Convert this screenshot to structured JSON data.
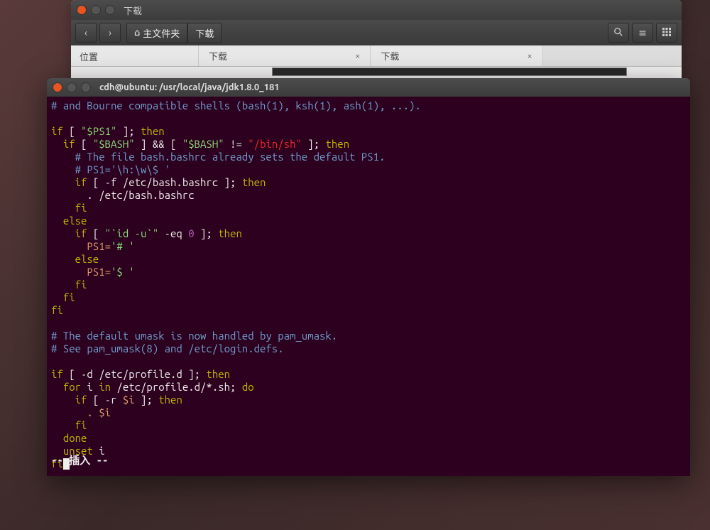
{
  "file_manager": {
    "title": "下载",
    "path": {
      "home": "主文件夹",
      "current": "下载"
    },
    "sidebar_label": "位置",
    "tabs": [
      {
        "label": "下载"
      },
      {
        "label": "下载"
      }
    ]
  },
  "terminal": {
    "title": "cdh@ubuntu: /usr/local/java/jdk1.8.0_181",
    "status": "-- 插入 --",
    "code": {
      "l1_pre": "# and Bourne compatible shells (bash(1), ksh(1), ash(1), ...).",
      "l3_if": "if",
      "l3_b1": " [ ",
      "l3_ps1": "\"$PS1\"",
      "l3_b2": " ]; ",
      "l3_then": "then",
      "l4_if": "if",
      "l4_b1": " [ ",
      "l4_bash1": "\"$BASH\"",
      "l4_b2": " ] ",
      "l4_and": "&&",
      "l4_b3": " [ ",
      "l4_bash2": "\"$BASH\"",
      "l4_ne": " != ",
      "l4_binsh": "\"/bin/sh\"",
      "l4_b4": " ]; ",
      "l4_then": "then",
      "l5": "# The file bash.bashrc already sets the default PS1.",
      "l6": "# PS1='\\h:\\w\\$ '",
      "l7_if": "if",
      "l7_b1": " [ -f /etc/bash.bashrc ]; ",
      "l7_then": "then",
      "l8": ". /etc/bash.bashrc",
      "l9_fi": "fi",
      "l10_else": "else",
      "l11_if": "if",
      "l11_b1": " [ ",
      "l11_id": "\"`id -u`\"",
      "l11_eq": " -eq ",
      "l11_zero": "0",
      "l11_b2": " ]; ",
      "l11_then": "then",
      "l12_ps1": "PS1=",
      "l12_val": "'# '",
      "l13_else": "else",
      "l14_ps1": "PS1=",
      "l14_val": "'$ '",
      "l15_fi": "fi",
      "l16_fi": "fi",
      "l17_fi": "fi",
      "l19": "# The default umask is now handled by pam_umask.",
      "l20": "# See pam_umask(8) and /etc/login.defs.",
      "l22_if": "if",
      "l22_b1": " [ -d /etc/profile.d ]; ",
      "l22_then": "then",
      "l23_for": "for",
      "l23_i": " i ",
      "l23_in": "in",
      "l23_path": " /etc/profile.d/*.sh; ",
      "l23_do": "do",
      "l24_if": "if",
      "l24_b1": " [ -r ",
      "l24_var": "$i",
      "l24_b2": " ]; ",
      "l24_then": "then",
      "l25_dot": ". ",
      "l25_var": "$i",
      "l26_fi": "fi",
      "l27_done": "done",
      "l28_unset": "unset",
      "l28_i": " i",
      "l29_fi": "fi"
    }
  }
}
